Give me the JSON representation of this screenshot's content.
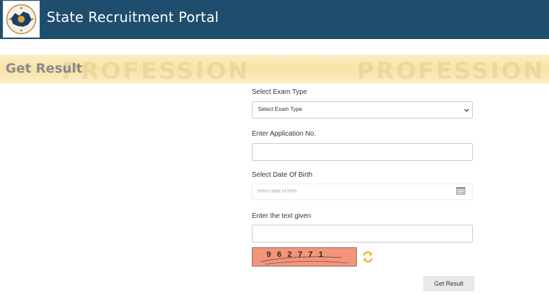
{
  "header": {
    "title": "State Recruitment Portal",
    "logo_icon": "state-emblem-logo"
  },
  "banner": {
    "title": "Get Result",
    "watermark": "PROFESSION"
  },
  "form": {
    "exam_type_label": "Select Exam Type",
    "exam_type_value": "Select Exam Type",
    "application_label": "Enter Application No.",
    "application_value": "",
    "dob_label": "Select Date Of Birth",
    "dob_placeholder": "Select date of birth",
    "captcha_label": "Enter the text given",
    "captcha_value": "",
    "captcha_text": "962771",
    "submit_label": "Get Result"
  },
  "colors": {
    "header_bg": "#1f4d6e",
    "banner_bg": "#f7e3a8",
    "captcha_bg": "#f3957b",
    "refresh_icon": "#f0b020"
  }
}
